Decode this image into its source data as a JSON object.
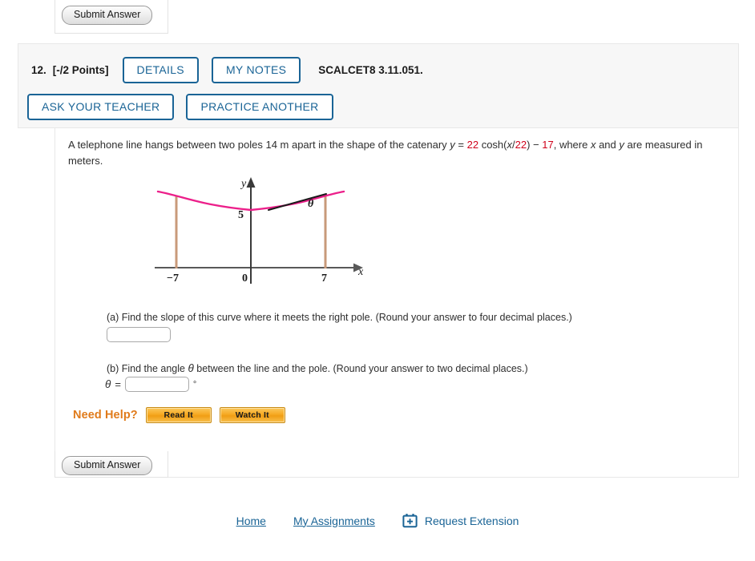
{
  "top_question": {
    "submit_label": "Submit Answer"
  },
  "question": {
    "number": "12.",
    "points": "[-/2 Points]",
    "details_label": "DETAILS",
    "my_notes_label": "MY NOTES",
    "code": "SCALCET8 3.11.051.",
    "ask_teacher_label": "ASK YOUR TEACHER",
    "practice_another_label": "PRACTICE ANOTHER",
    "prompt": {
      "part1": "A telephone line hangs between two poles 14 m apart in the shape of the catenary ",
      "y_var": "y",
      "eq_sign": " = ",
      "coef": "22",
      "cosh_open": " cosh(",
      "x_var": "x",
      "slash": "/",
      "inner": "22",
      "cosh_close": ") ",
      "minus": "− ",
      "const": "17",
      "part2": ",  where ",
      "x_var2": "x",
      "and_text": " and ",
      "y_var2": "y",
      "part3": " are measured in meters."
    },
    "part_a": {
      "text": "(a) Find the slope of this curve where it meets the right pole. (Round your answer to four decimal places.)",
      "value": "",
      "placeholder": ""
    },
    "part_b": {
      "text_pre": "(b) Find the angle ",
      "theta": "θ",
      "text_post": " between the line and the pole. (Round your answer to two decimal places.)",
      "label_theta": "θ",
      "label_eq": "=",
      "value": "",
      "placeholder": "",
      "degree_symbol": "°"
    },
    "need_help": {
      "label": "Need Help?",
      "read_it": "Read It",
      "watch_it": "Watch It"
    },
    "submit_label": "Submit Answer"
  },
  "figure": {
    "y_axis_label": "y",
    "x_axis_label": "x",
    "tick_left": "−7",
    "tick_origin": "0",
    "tick_right": "7",
    "tick_y": "5",
    "theta_label": "θ",
    "curve_color": "#ec1f8a",
    "pole_color": "#c89a7a",
    "axis_color": "#595959",
    "tangent_color": "#1a1a1a",
    "description": "Catenary curve y = 22cosh(x/22) - 17 between two vertical poles at x = -7 and x = 7, with tangent line and angle theta at the right pole."
  },
  "footer": {
    "home": "Home",
    "my_assignments": "My Assignments",
    "request_extension": "Request Extension",
    "calendar_icon": "calendar-plus-icon"
  },
  "colors": {
    "accent_blue": "#1a6496",
    "help_orange": "#e07b1b",
    "red_value": "#d0021b"
  }
}
